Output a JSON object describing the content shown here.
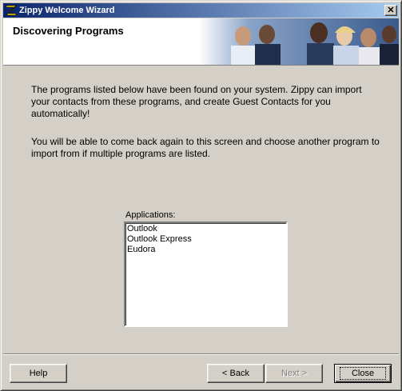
{
  "window": {
    "title": "Zippy Welcome Wizard"
  },
  "header": {
    "title": "Discovering Programs"
  },
  "body": {
    "paragraph1": "The programs listed below have been found on your system. Zippy can import your contacts from these programs, and create Guest Contacts for you automatically!",
    "paragraph2": "You will be able to come back again to this screen and choose another program to import from if multiple programs are listed."
  },
  "applications": {
    "label": "Applications:",
    "items": [
      "Outlook",
      "Outlook Express",
      "Eudora"
    ]
  },
  "buttons": {
    "help": "Help",
    "back": "< Back",
    "next": "Next >",
    "close": "Close"
  },
  "icons": {
    "app": "zippy-logo-icon",
    "close": "close-icon"
  },
  "colors": {
    "titlebar_start": "#0a246a",
    "titlebar_end": "#a6caf0",
    "face": "#d4d0c8"
  }
}
